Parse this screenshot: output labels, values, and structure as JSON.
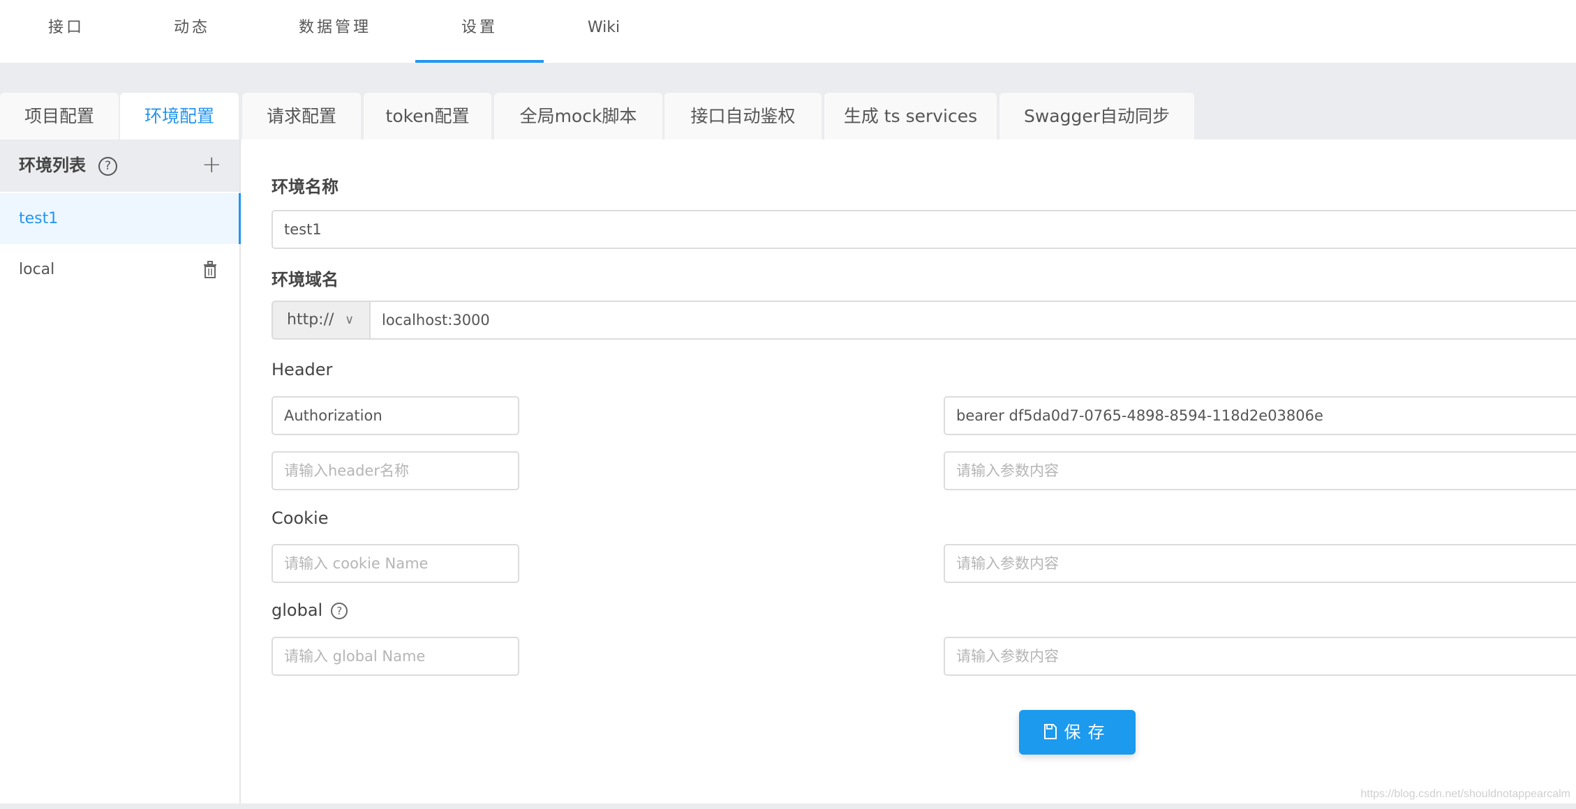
{
  "topnav": {
    "items": [
      {
        "label": "接口"
      },
      {
        "label": "动态"
      },
      {
        "label": "数据管理"
      },
      {
        "label": "设置",
        "active": true
      },
      {
        "label": "Wiki"
      }
    ]
  },
  "tabs": [
    {
      "label": "项目配置"
    },
    {
      "label": "环境配置",
      "active": true
    },
    {
      "label": "请求配置"
    },
    {
      "label": "token配置"
    },
    {
      "label": "全局mock脚本"
    },
    {
      "label": "接口自动鉴权"
    },
    {
      "label": "生成 ts services"
    },
    {
      "label": "Swagger自动同步"
    }
  ],
  "sidebar": {
    "title": "环境列表",
    "help_icon": "question-circle-icon",
    "add_icon": "plus-icon",
    "items": [
      {
        "label": "test1",
        "active": true
      },
      {
        "label": "local",
        "icon": "trash-icon"
      }
    ]
  },
  "form": {
    "env_name_label": "环境名称",
    "env_name_value": "test1",
    "env_domain_label": "环境域名",
    "protocol_value": "http://",
    "domain_value": "localhost:3000",
    "header_label": "Header",
    "headers": [
      {
        "name_value": "Authorization",
        "name_placeholder": "请输入header名称",
        "value_value": "bearer df5da0d7-0765-4898-8594-118d2e03806e",
        "value_placeholder": "请输入参数内容"
      },
      {
        "name_value": "",
        "name_placeholder": "请输入header名称",
        "value_value": "",
        "value_placeholder": "请输入参数内容"
      }
    ],
    "cookie_label": "Cookie",
    "cookie": {
      "name_placeholder": "请输入 cookie Name",
      "value_placeholder": "请输入参数内容"
    },
    "global_label": "global",
    "global": {
      "name_placeholder": "请输入 global Name",
      "value_placeholder": "请输入参数内容"
    },
    "save_label": "保存"
  },
  "watermark": "https://blog.csdn.net/shouldnotappearcalm"
}
